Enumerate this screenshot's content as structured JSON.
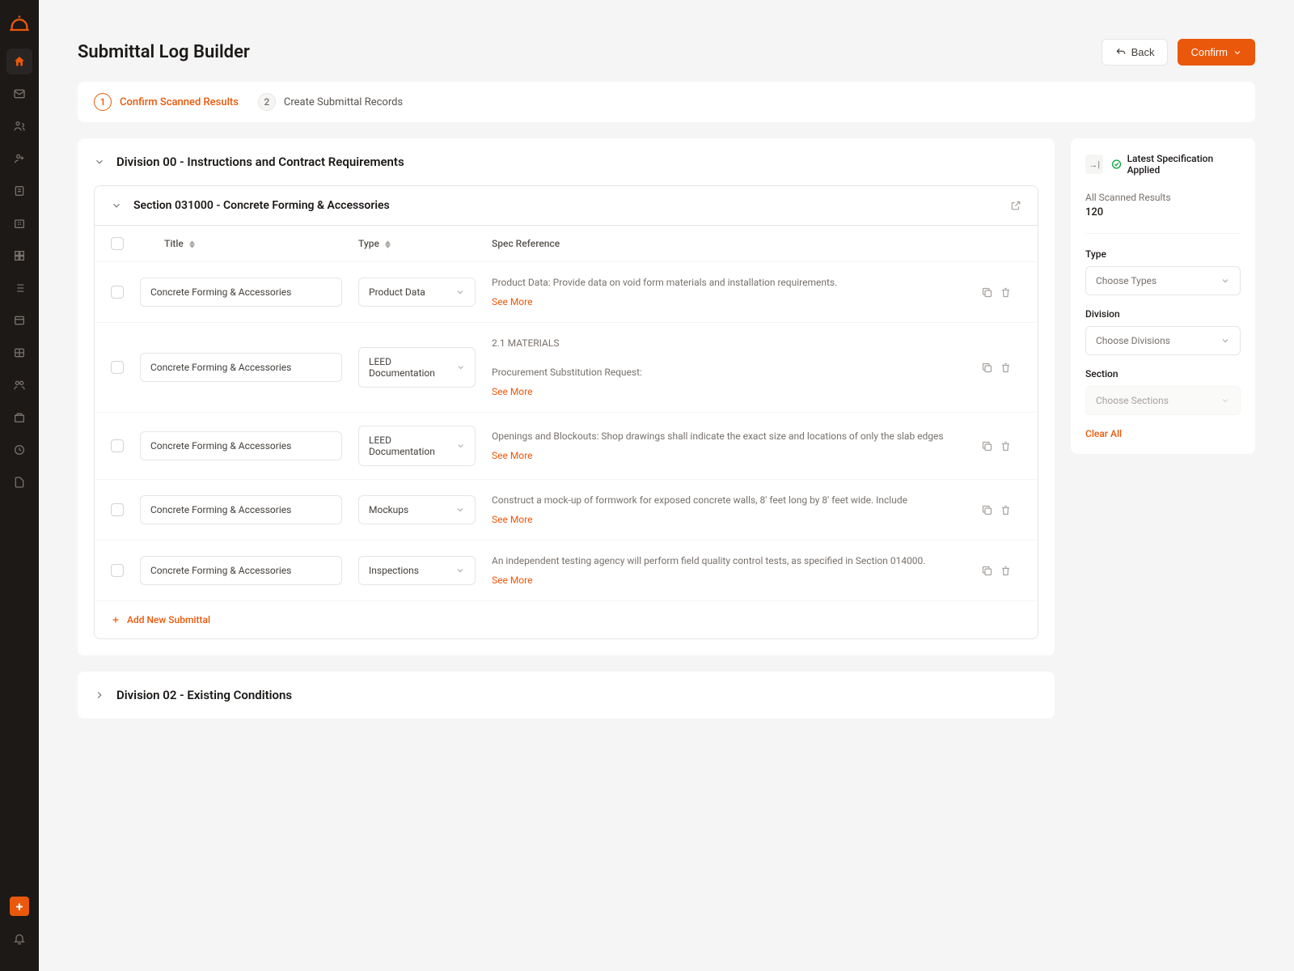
{
  "header": {
    "title": "Submittal Log Builder",
    "back_label": "Back",
    "confirm_label": "Confirm"
  },
  "steps": [
    {
      "num": "1",
      "label": "Confirm Scanned Results",
      "active": true
    },
    {
      "num": "2",
      "label": "Create Submittal Records",
      "active": false
    }
  ],
  "divisions": [
    {
      "title": "Division 00 - Instructions and Contract Requirements",
      "expanded": true,
      "sections": [
        {
          "title": "Section 031000 - Concrete Forming & Accessories",
          "columns": {
            "title": "Title",
            "type": "Type",
            "spec": "Spec Reference"
          },
          "rows": [
            {
              "title": "Concrete Forming & Accessories",
              "type": "Product Data",
              "spec": "Product Data: Provide data on void form materials and installation requirements."
            },
            {
              "title": "Concrete Forming & Accessories",
              "type": "LEED Documentation",
              "spec_pre": "2.1  MATERIALS",
              "spec": "Procurement Substitution Request:"
            },
            {
              "title": "Concrete Forming & Accessories",
              "type": "LEED Documentation",
              "spec": "Openings and Blockouts: Shop drawings shall indicate the exact size and locations of only the slab edges"
            },
            {
              "title": "Concrete Forming & Accessories",
              "type": "Mockups",
              "spec": "Construct a mock-up of formwork for exposed concrete walls, 8' feet long by 8' feet wide. Include"
            },
            {
              "title": "Concrete Forming & Accessories",
              "type": "Inspections",
              "spec": "An independent testing agency will perform field quality control tests, as specified in Section 014000."
            }
          ],
          "see_more": "See More",
          "add_label": "Add New Submittal"
        }
      ]
    },
    {
      "title": "Division 02 - Existing Conditions",
      "expanded": false
    }
  ],
  "filters": {
    "spec_applied": "Latest Specification Applied",
    "results_label": "All Scanned Results",
    "results_count": "120",
    "type_label": "Type",
    "type_placeholder": "Choose Types",
    "division_label": "Division",
    "division_placeholder": "Choose Divisions",
    "section_label": "Section",
    "section_placeholder": "Choose Sections",
    "clear_all": "Clear All"
  }
}
